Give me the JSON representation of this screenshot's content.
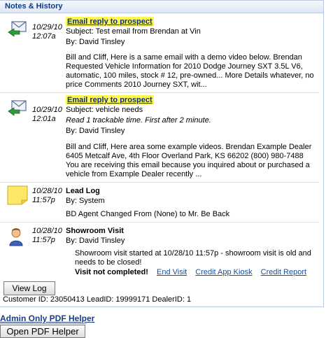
{
  "panel": {
    "title": "Notes & History"
  },
  "entries": [
    {
      "icon": "email-reply-icon",
      "date": "10/29/10",
      "time": "12:07a",
      "title": "Email reply to prospect",
      "subject": "Subject: Test email from Brendan at Vin",
      "by": "By: David Tinsley",
      "message": "Bill and Cliff,   Here is a same email with a demo video below.   Brendan Requested Vehicle Information for 2010 Dodge Journey SXT 3.5L V6, automatic, 100 miles, stock # 12, pre-owned... More Details whatever, no price Comments 2010 Journey SXT, wit..."
    },
    {
      "icon": "email-reply-icon",
      "date": "10/29/10",
      "time": "12:01a",
      "title": "Email reply to prospect",
      "subject": "Subject: vehicle needs",
      "note": "Read 1 trackable time. First after 2 minute.",
      "by": "By: David Tinsley",
      "message": "Bill and Cliff, Here area some example videos. Brendan   Example Dealer 6405 Metcalf Ave, 4th Floor Overland Park, KS 66202 (800) 980-7488 You are receiving this email because you inquired about or purchased a vehicle from Example Dealer recently ..."
    },
    {
      "icon": "sticky-note-icon",
      "date": "10/28/10",
      "time": "11:57p",
      "title": "Lead Log",
      "by": "By: System",
      "message": "BD Agent Changed From (None) to Mr. Be Back"
    },
    {
      "icon": "person-icon",
      "date": "10/28/10",
      "time": "11:57p",
      "title": "Showroom Visit",
      "by": "By: David Tinsley",
      "message": "Showroom visit started at 10/28/10 11:57p - showroom visit is old and needs to be closed!",
      "warning": "Visit not completed!",
      "links": [
        "End Visit",
        "Credit App Kiosk",
        "Credit Report"
      ]
    }
  ],
  "buttons": {
    "view_log": "View Log",
    "open_pdf": "Open PDF Helper"
  },
  "footer": {
    "ids": "Customer ID: 23050413 LeadID: 19999171 DealerID: 1"
  },
  "admin": {
    "label": "Admin Only PDF Helper"
  }
}
